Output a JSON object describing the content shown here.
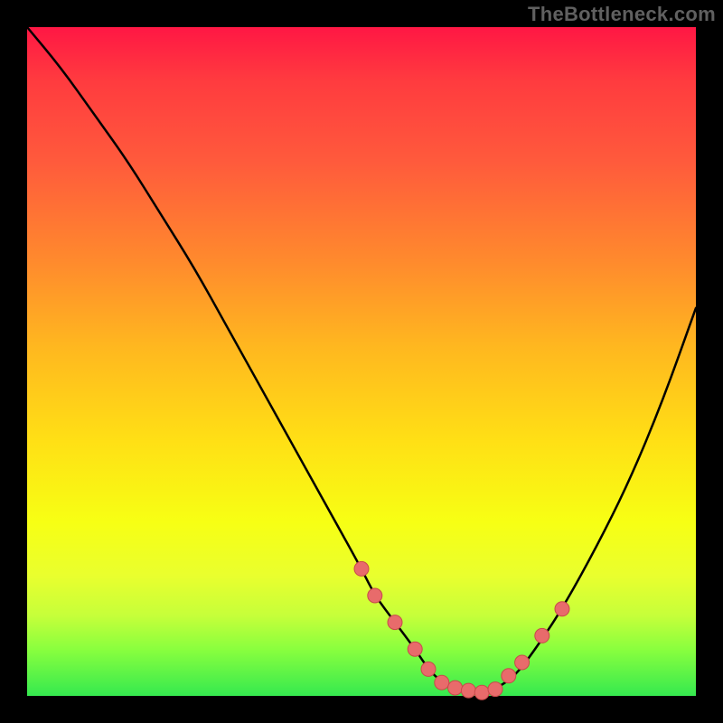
{
  "branding": {
    "watermark": "TheBottleneck.com"
  },
  "colors": {
    "page_bg": "#000000",
    "curve": "#000000",
    "marker_fill": "#e86b6b",
    "marker_stroke": "#c84a4a",
    "gradient_top": "#ff1744",
    "gradient_bottom": "#35e94f"
  },
  "chart_data": {
    "type": "line",
    "title": "",
    "xlabel": "",
    "ylabel": "",
    "xlim": [
      0,
      100
    ],
    "ylim": [
      0,
      100
    ],
    "grid": false,
    "legend": false,
    "series": [
      {
        "name": "bottleneck-curve",
        "x": [
          0,
          5,
          10,
          15,
          20,
          25,
          30,
          35,
          40,
          45,
          50,
          52,
          55,
          58,
          60,
          62,
          65,
          68,
          70,
          73,
          76,
          80,
          85,
          90,
          95,
          100
        ],
        "y": [
          100,
          94,
          87,
          80,
          72,
          64,
          55,
          46,
          37,
          28,
          19,
          15,
          11,
          7,
          4,
          2,
          1,
          0.5,
          1,
          3,
          7,
          13,
          22,
          32,
          44,
          58
        ]
      }
    ],
    "markers": {
      "name": "highlight-points",
      "x": [
        50,
        52,
        55,
        58,
        60,
        62,
        64,
        66,
        68,
        70,
        72,
        74,
        77,
        80
      ],
      "y": [
        19,
        15,
        11,
        7,
        4,
        2,
        1.2,
        0.8,
        0.5,
        1,
        3,
        5,
        9,
        13
      ]
    }
  }
}
